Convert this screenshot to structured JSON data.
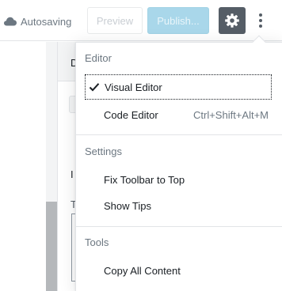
{
  "header": {
    "autosave_label": "Autosaving",
    "preview_label": "Preview",
    "publish_label": "Publish...",
    "settings_icon": "gear-icon",
    "more_icon": "vertical-ellipsis-icon"
  },
  "background": {
    "panel_tab_char": "D",
    "panel_char_1": "I",
    "panel_char_2": "T"
  },
  "menu": {
    "groups": [
      {
        "label": "Editor",
        "items": [
          {
            "label": "Visual Editor",
            "checked": true,
            "shortcut": ""
          },
          {
            "label": "Code Editor",
            "checked": false,
            "shortcut": "Ctrl+Shift+Alt+M"
          }
        ]
      },
      {
        "label": "Settings",
        "items": [
          {
            "label": "Fix Toolbar to Top"
          },
          {
            "label": "Show Tips"
          }
        ]
      },
      {
        "label": "Tools",
        "items": [
          {
            "label": "Copy All Content"
          }
        ]
      }
    ]
  },
  "colors": {
    "settings_button_bg": "#555d66",
    "publish_button_bg": "#a9d7ea",
    "text_primary": "#191e23",
    "text_muted": "#6c7781"
  }
}
